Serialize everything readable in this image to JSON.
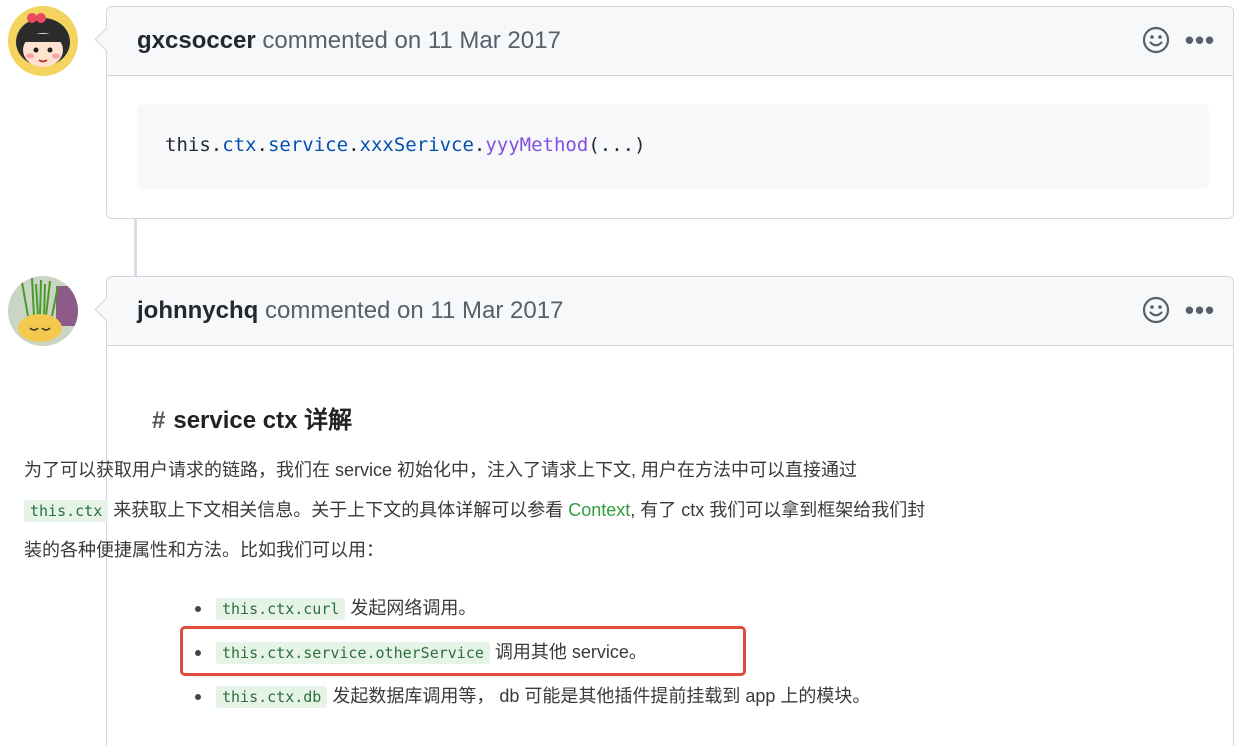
{
  "comments": [
    {
      "author": "gxcsoccer",
      "meta": "commented on 11 Mar 2017",
      "code": {
        "t1": "this.",
        "t2": "ctx",
        "t3": ".",
        "t4": "service",
        "t5": ".",
        "t6": "xxxSerivce",
        "t7": ".",
        "t8": "yyyMethod",
        "t9": "(...)"
      }
    },
    {
      "author": "johnnychq",
      "meta": "commented on 11 Mar 2017"
    }
  ],
  "header_icons": {
    "reaction": "smiley-icon",
    "more": "kebab-icon",
    "more_label": "•••"
  },
  "embed": {
    "hash": "#",
    "title": "service ctx 详解",
    "para1": "为了可以获取用户请求的链路，我们在 service 初始化中，注入了请求上下文, 用户在方法中可以直接通过",
    "para2_code": "this.ctx",
    "para2_a": " 来获取上下文相关信息。关于上下文的具体详解可以参看 ",
    "para2_link": "Context",
    "para2_b": ", 有了 ctx 我们可以拿到框架给我们封",
    "para3": "装的各种便捷属性和方法。比如我们可以用：",
    "bullets": [
      {
        "code": "this.ctx.curl",
        "text": " 发起网络调用。"
      },
      {
        "code": "this.ctx.service.otherService",
        "text": " 调用其他 service。"
      },
      {
        "code": "this.ctx.db",
        "text": " 发起数据库调用等， db 可能是其他插件提前挂载到 app 上的模块。"
      }
    ]
  },
  "colors": {
    "highlight": "#e04b3a",
    "link": "#2e9e3e",
    "header_bg": "#f6f8fa",
    "border": "#d0d7de"
  }
}
